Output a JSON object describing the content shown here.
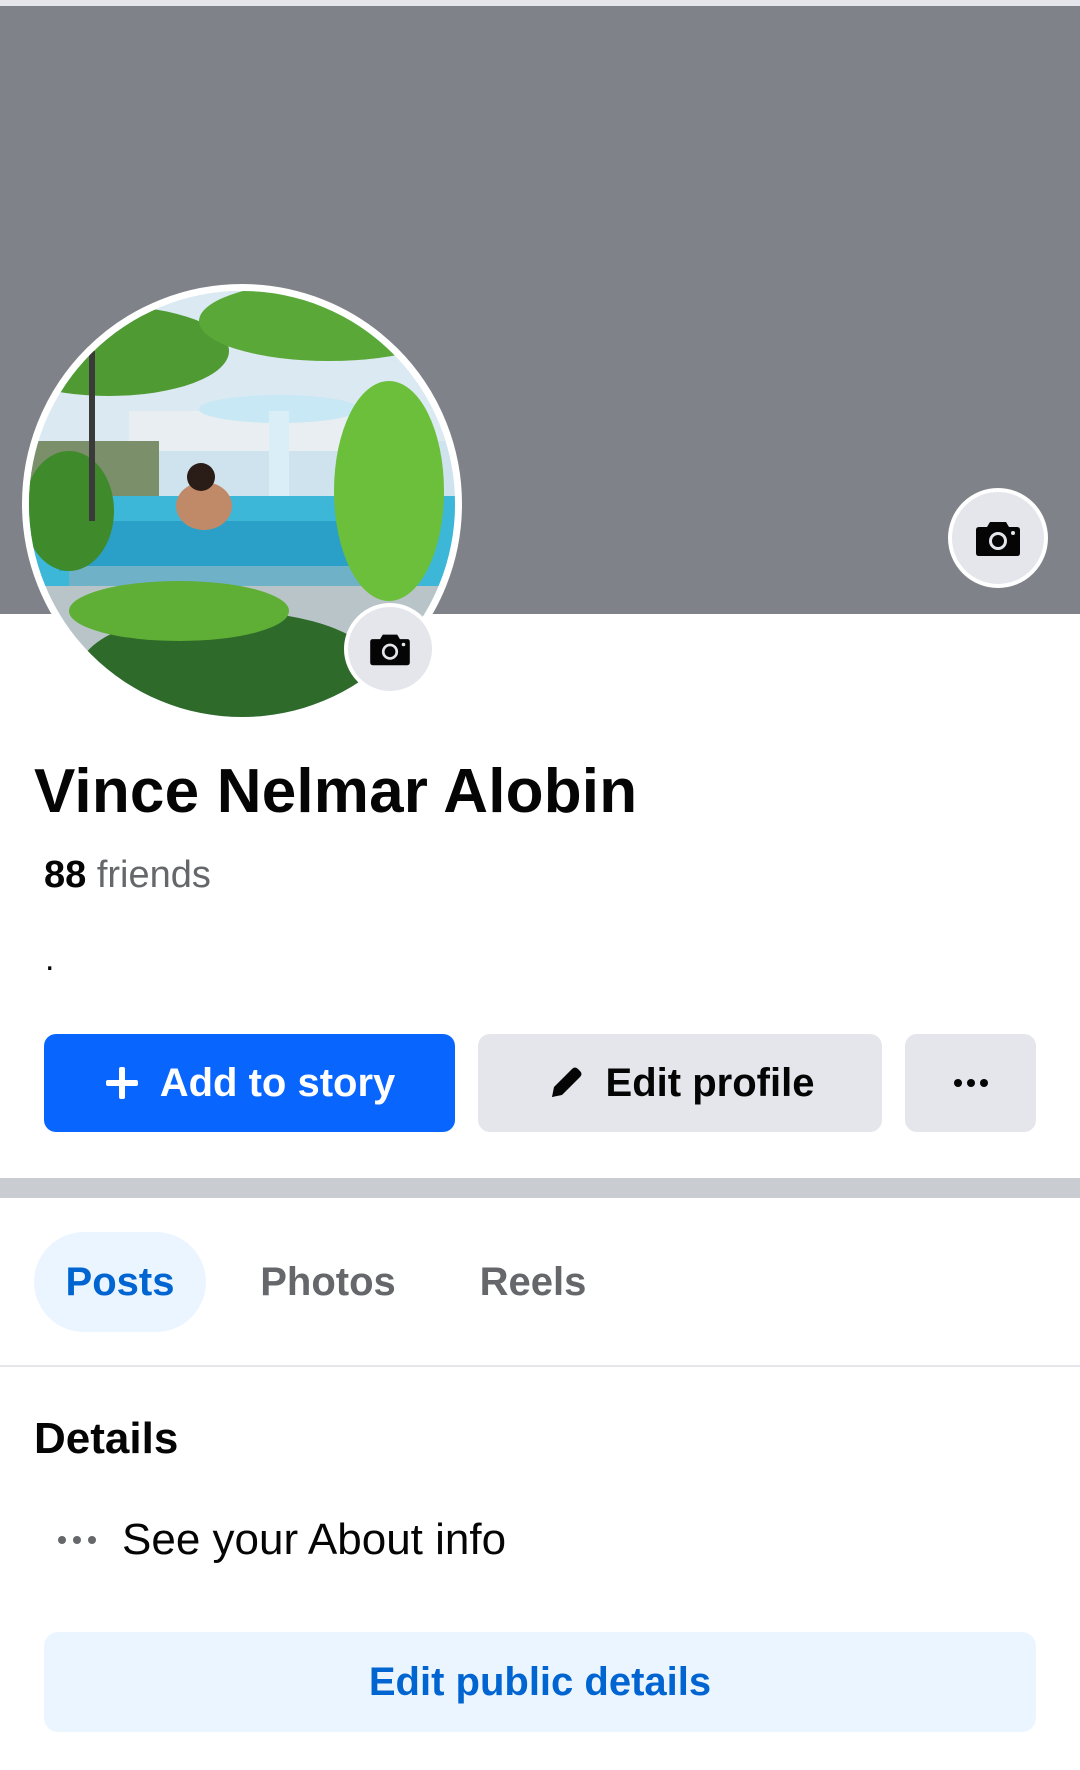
{
  "profile": {
    "name": "Vince Nelmar Alobin",
    "friends_count": "88",
    "friends_label": "friends",
    "bio": "."
  },
  "actions": {
    "add_to_story": "Add to story",
    "edit_profile": "Edit profile",
    "more": "···"
  },
  "tabs": [
    {
      "label": "Posts",
      "active": true
    },
    {
      "label": "Photos",
      "active": false
    },
    {
      "label": "Reels",
      "active": false
    }
  ],
  "details": {
    "title": "Details",
    "about_text": "See your About info",
    "edit_public_label": "Edit public details"
  },
  "icons": {
    "cover_camera": "camera-icon",
    "avatar_camera": "camera-icon",
    "add": "plus-icon",
    "edit": "pencil-icon",
    "more": "more-dots-icon",
    "about": "more-dots-icon"
  },
  "colors": {
    "primary": "#0866ff",
    "link": "#0064d1",
    "cover": "#7f8288",
    "secondary_button": "#e4e6eb",
    "tab_active_bg": "#ebf5ff"
  }
}
